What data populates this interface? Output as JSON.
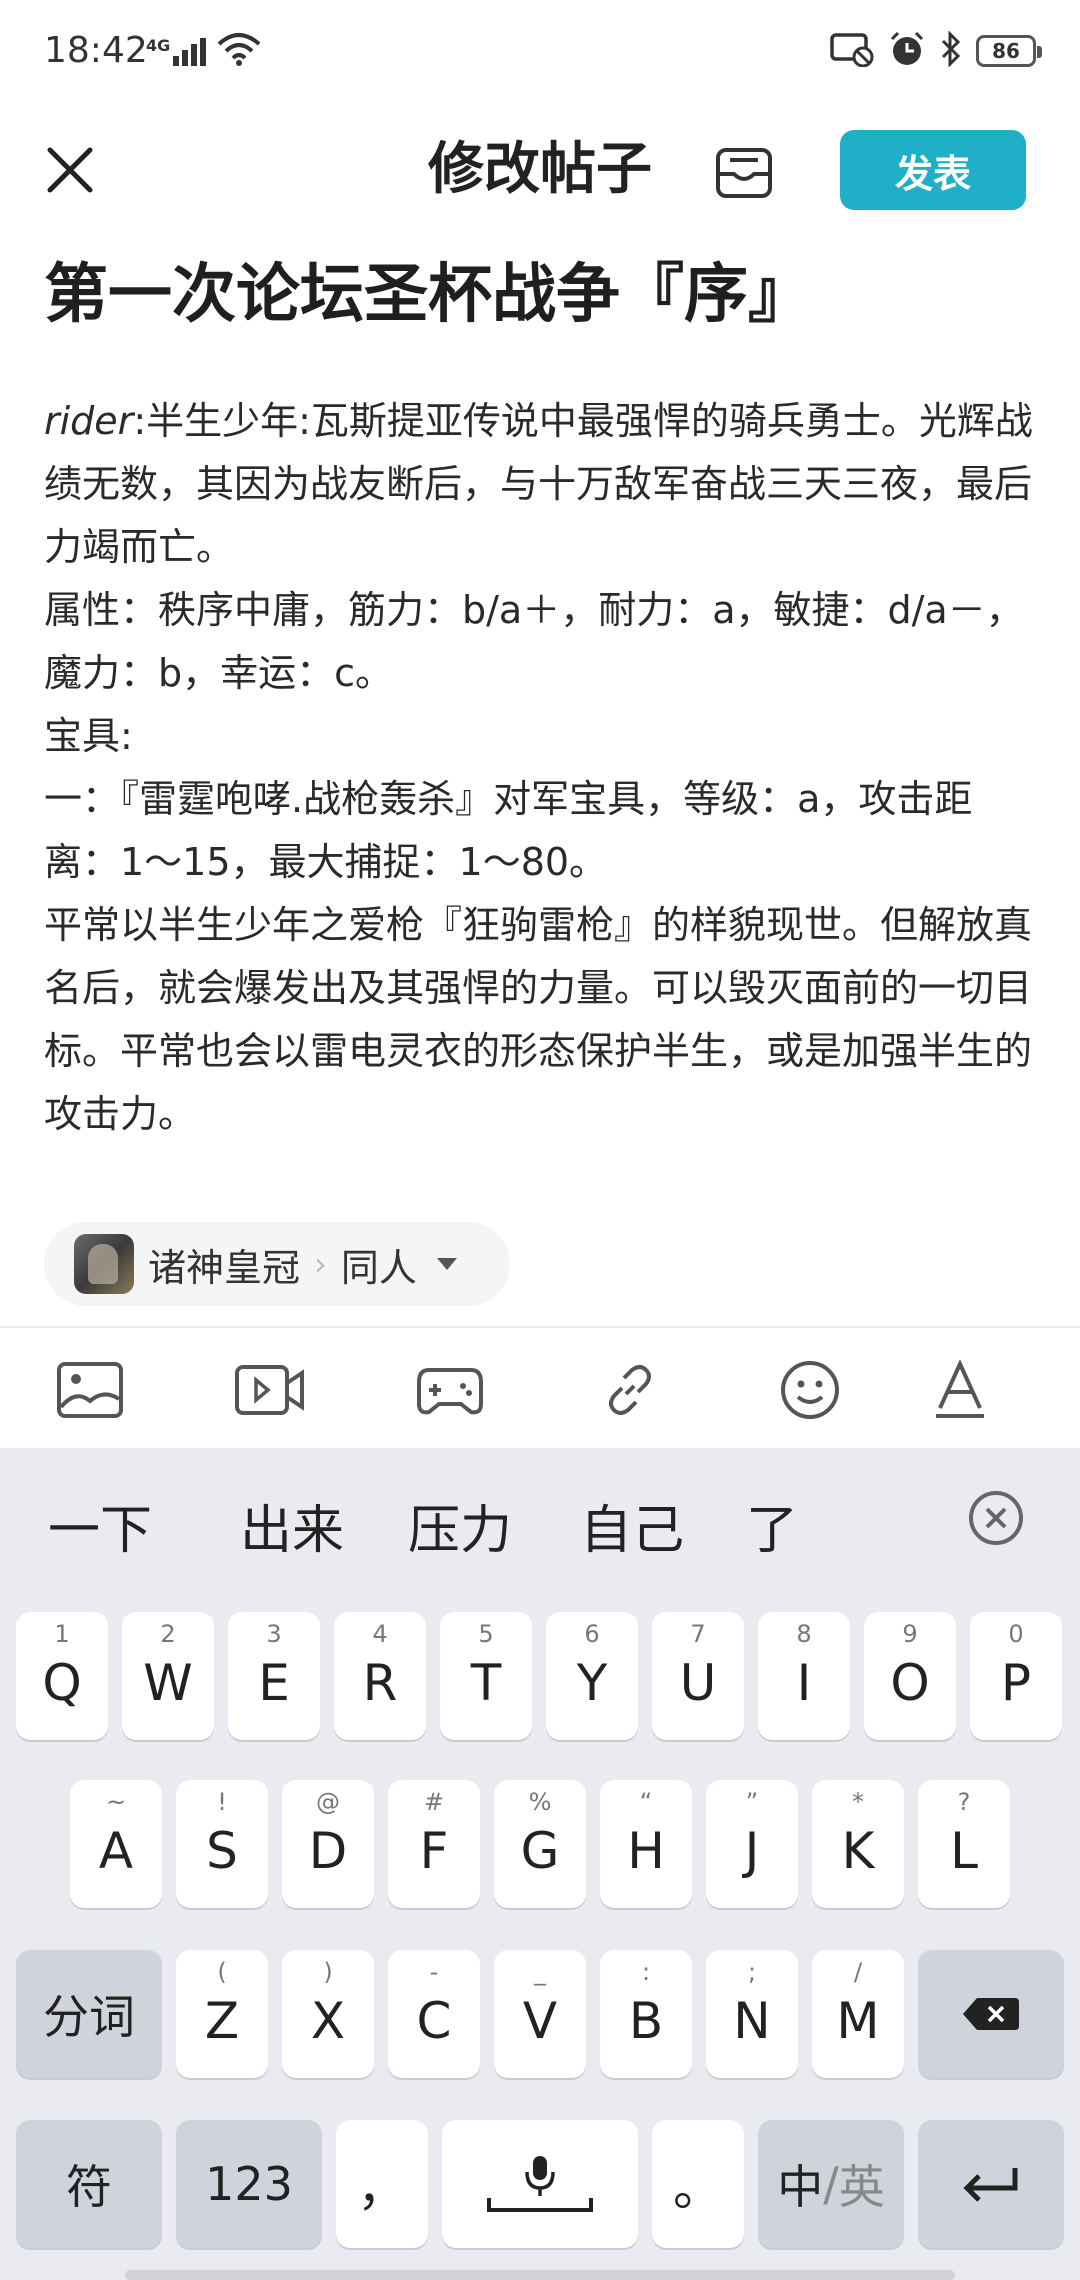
{
  "status_bar": {
    "time": "18:42",
    "network": "4G",
    "battery": "86"
  },
  "header": {
    "title": "修改帖子",
    "publish_label": "发表"
  },
  "post": {
    "title": "第一次论坛圣杯战争『序』",
    "body_lead_italic": "rider",
    "body_lines": [
      ":半生少年:瓦斯提亚传说中最强悍的骑兵勇士。光辉战绩无数，其因为战友断后，与十万敌军奋战三天三夜，最后力竭而亡。",
      "属性：秩序中庸，筋力：b/a＋，耐力：a，敏捷：d/a－，魔力：b，幸运：c。",
      "宝具:",
      "一：『雷霆咆哮.战枪轰杀』对军宝具，等级：a，攻击距离：1～15，最大捕捉：1～80。",
      "平常以半生少年之爱枪『狂驹雷枪』的样貌现世。但解放真名后，就会爆发出及其强悍的力量。可以毁灭面前的一切目标。平常也会以雷电灵衣的形态保护半生，或是加强半生的攻击力。"
    ]
  },
  "forum_chip": {
    "forum": "诸神皇冠",
    "separator": "›",
    "section": "同人"
  },
  "keyboard": {
    "candidates": [
      "一下",
      "出来",
      "压力",
      "自己",
      "了"
    ],
    "row1": [
      {
        "main": "Q",
        "sub": "1"
      },
      {
        "main": "W",
        "sub": "2"
      },
      {
        "main": "E",
        "sub": "3"
      },
      {
        "main": "R",
        "sub": "4"
      },
      {
        "main": "T",
        "sub": "5"
      },
      {
        "main": "Y",
        "sub": "6"
      },
      {
        "main": "U",
        "sub": "7"
      },
      {
        "main": "I",
        "sub": "8"
      },
      {
        "main": "O",
        "sub": "9"
      },
      {
        "main": "P",
        "sub": "0"
      }
    ],
    "row2": [
      {
        "main": "A",
        "sub": "~"
      },
      {
        "main": "S",
        "sub": "!"
      },
      {
        "main": "D",
        "sub": "@"
      },
      {
        "main": "F",
        "sub": "#"
      },
      {
        "main": "G",
        "sub": "%"
      },
      {
        "main": "H",
        "sub": "“"
      },
      {
        "main": "J",
        "sub": "”"
      },
      {
        "main": "K",
        "sub": "*"
      },
      {
        "main": "L",
        "sub": "?"
      }
    ],
    "row3_left": "分词",
    "row3": [
      {
        "main": "Z",
        "sub": "("
      },
      {
        "main": "X",
        "sub": ")"
      },
      {
        "main": "C",
        "sub": "-"
      },
      {
        "main": "V",
        "sub": "_"
      },
      {
        "main": "B",
        "sub": ":"
      },
      {
        "main": "N",
        "sub": ";"
      },
      {
        "main": "M",
        "sub": "/"
      }
    ],
    "row4": {
      "symbols": "符",
      "numbers": "123",
      "comma": "，",
      "period": "。",
      "lang_zh": "中",
      "lang_sep": "/",
      "lang_en": "英"
    }
  },
  "colors": {
    "accent": "#1fb0c8",
    "keyboard_bg": "#e9ebf1",
    "key_dark": "#cfd3dc"
  }
}
